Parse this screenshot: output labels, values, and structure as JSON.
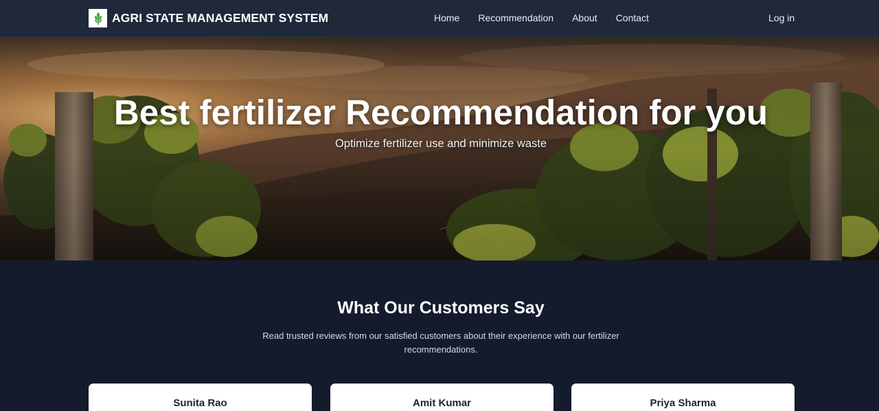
{
  "app": {
    "title": "AGRI STATE MANAGEMENT SYSTEM",
    "logo_icon": "leaf-plant-icon"
  },
  "nav": {
    "links": [
      {
        "label": "Home"
      },
      {
        "label": "Recommendation"
      },
      {
        "label": "About"
      },
      {
        "label": "Contact"
      }
    ],
    "login_label": "Log in"
  },
  "hero": {
    "title": "Best fertilizer Recommendation for you",
    "subtitle": "Optimize fertilizer use and minimize waste",
    "background_icon": "vineyard-sunset-photo"
  },
  "testimonials": {
    "title": "What Our Customers Say",
    "description": "Read trusted reviews from our satisfied customers about their experience with our fertilizer recommendations.",
    "cards": [
      {
        "name": "Sunita Rao"
      },
      {
        "name": "Amit Kumar"
      },
      {
        "name": "Priya Sharma"
      }
    ]
  },
  "colors": {
    "navbar_bg": "#1f293a",
    "page_bg": "#141b2d",
    "card_bg": "#ffffff",
    "text_primary": "#ffffff"
  }
}
